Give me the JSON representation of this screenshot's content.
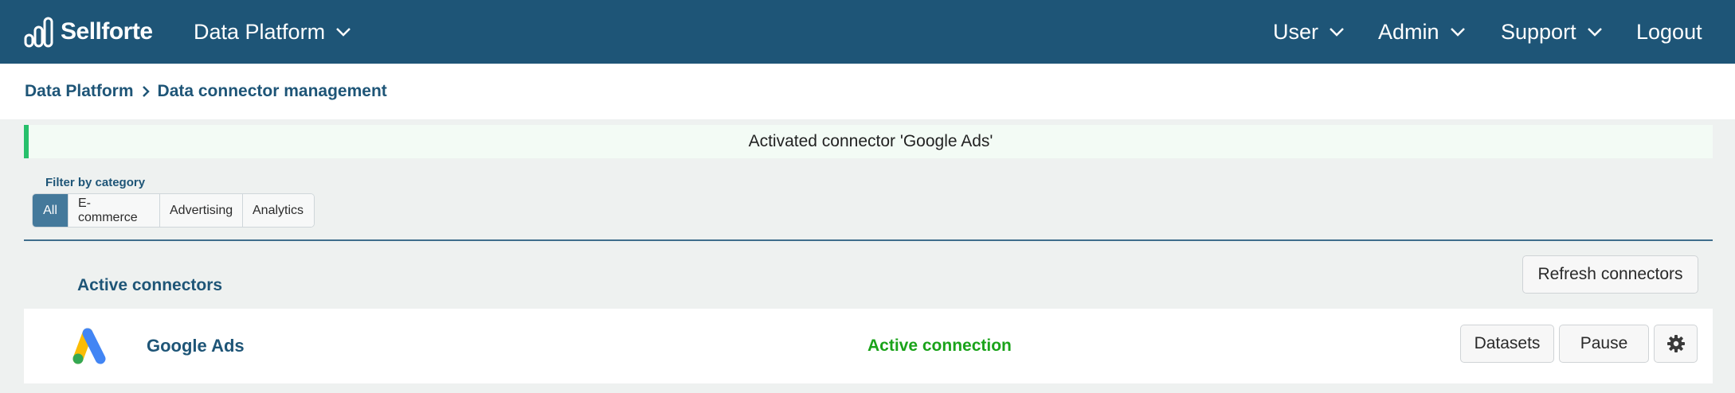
{
  "brand": {
    "name": "Sellforte"
  },
  "nav": {
    "platform": "Data Platform",
    "user": "User",
    "admin": "Admin",
    "support": "Support",
    "logout": "Logout"
  },
  "breadcrumb": {
    "root": "Data Platform",
    "current": "Data connector management"
  },
  "alert": {
    "message": "Activated connector 'Google Ads'"
  },
  "filter": {
    "label": "Filter by category",
    "options": [
      "All",
      "E-commerce",
      "Advertising",
      "Analytics"
    ],
    "selected": "All"
  },
  "section": {
    "title": "Active connectors",
    "refresh_label": "Refresh connectors"
  },
  "connectors": [
    {
      "name": "Google Ads",
      "status": "Active connection",
      "datasets_label": "Datasets",
      "pause_label": "Pause",
      "icon": "google-ads-logo"
    }
  ],
  "colors": {
    "nav_bg": "#1e5577",
    "accent": "#44799b",
    "success": "#27c06b",
    "status_active": "#1aa31a"
  }
}
